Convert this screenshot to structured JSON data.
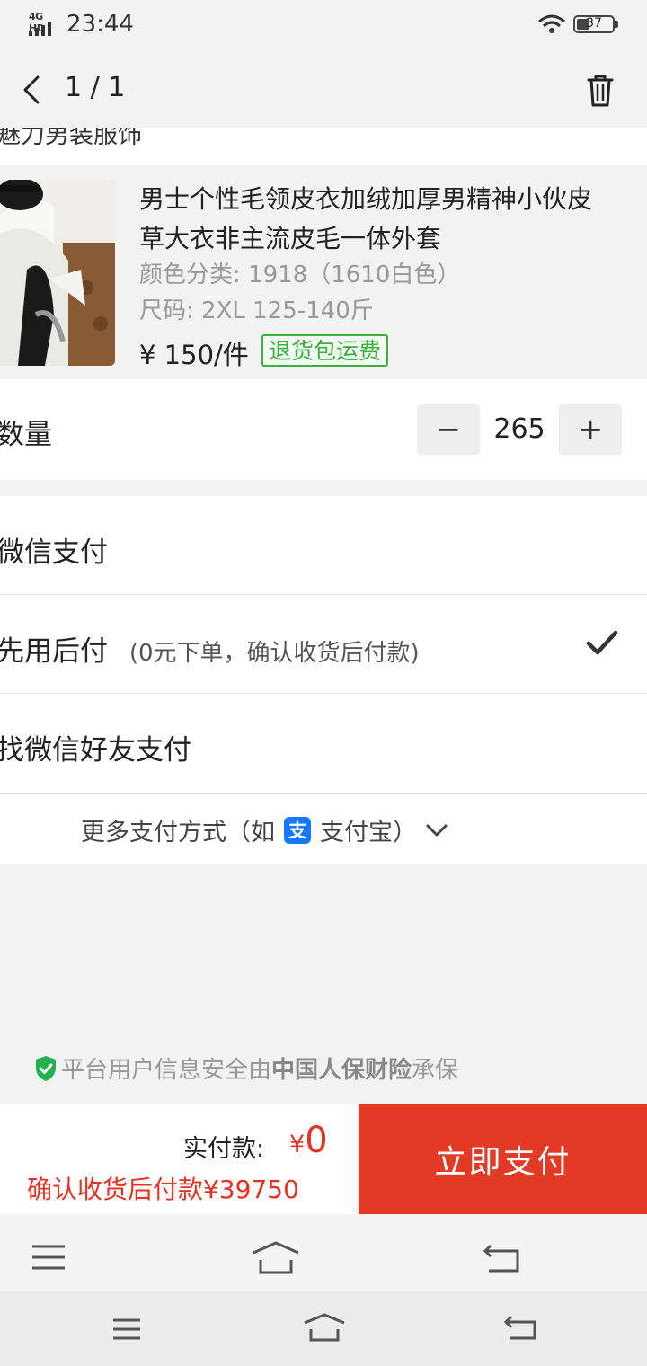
{
  "status_bar": {
    "network": "4G HD",
    "time": "23:44",
    "battery": "37"
  },
  "header": {
    "page_indicator": "1 / 1"
  },
  "product": {
    "shop_name": "魅力男装服饰",
    "title": "男士个性毛领皮衣加绒加厚男精神小伙皮草大衣非主流皮毛一体外套",
    "color_spec": "颜色分类: 1918（1610白色）",
    "size_spec": "尺码: 2XL 125-140斤",
    "price": "¥ 150/件",
    "return_badge": "退货包运费"
  },
  "quantity": {
    "label": "数量",
    "minus": "−",
    "value": "265",
    "plus": "+"
  },
  "payment": {
    "option_wechat": "微信支付",
    "option_later": "先用后付",
    "option_later_note": "(0元下单，确认收货后付款)",
    "option_friend": "找微信好友支付",
    "more_prefix": "更多支付方式（如",
    "alipay_glyph": "支",
    "more_suffix": "支付宝）"
  },
  "insurance": {
    "prefix": "平台用户信息安全由",
    "insurer": "中国人保财险",
    "suffix": "承保"
  },
  "bottom_bar": {
    "paid_label": "实付款:",
    "paid_currency": "¥",
    "paid_value": "0",
    "pay_later_line": "确认收货后付款¥39750",
    "pay_button": "立即支付"
  },
  "colors": {
    "accent_red": "#e33a26",
    "badge_green": "#3caf3f",
    "alipay_blue": "#1677ff"
  }
}
